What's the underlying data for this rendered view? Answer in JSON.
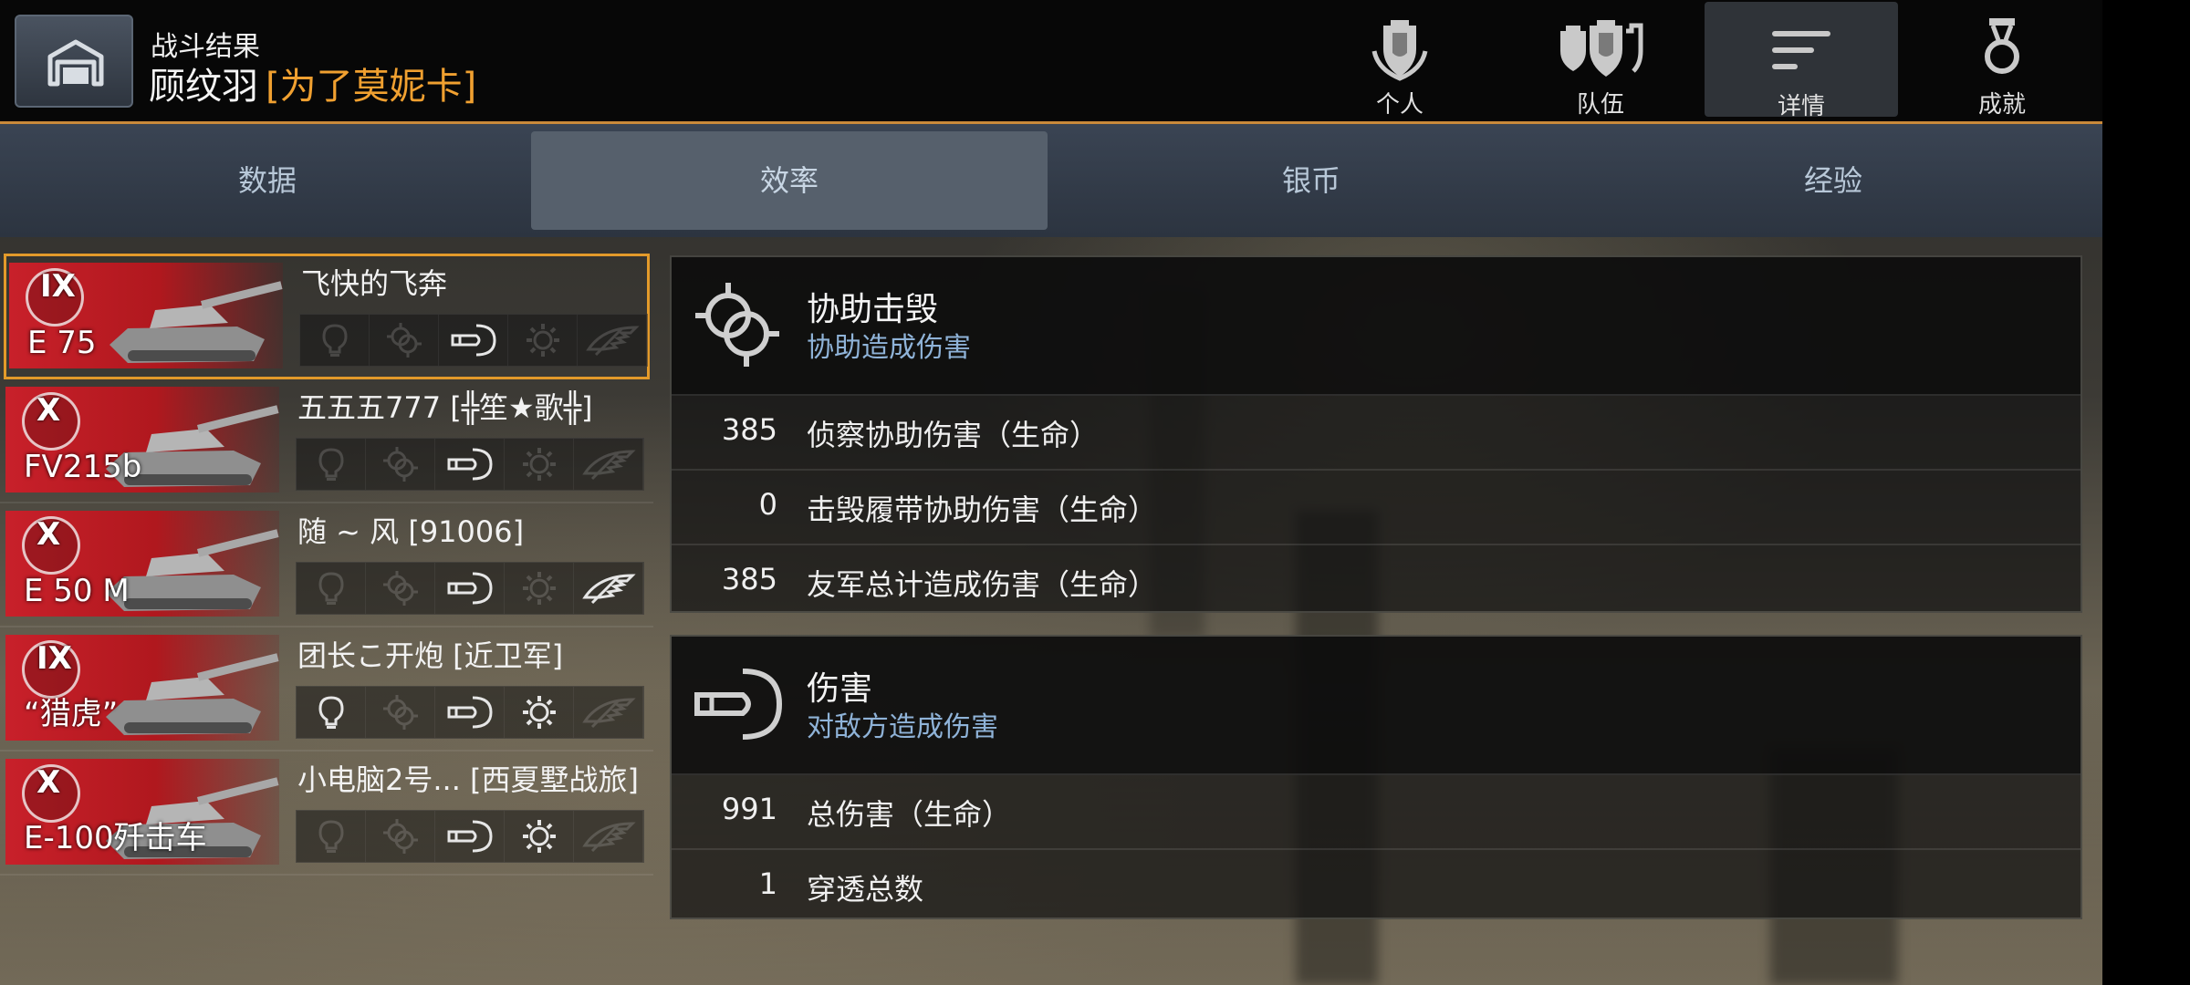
{
  "header": {
    "subtitle": "战斗结果",
    "player_name": "顾纹羽",
    "player_clan": "[为了莫妮卡]"
  },
  "nav": [
    {
      "label": "个人",
      "icon": "personal-badge-icon",
      "active": false
    },
    {
      "label": "队伍",
      "icon": "team-badge-icon",
      "active": false
    },
    {
      "label": "详情",
      "icon": "details-list-icon",
      "active": true
    },
    {
      "label": "成就",
      "icon": "medal-icon",
      "active": false
    }
  ],
  "tabs": [
    {
      "label": "数据",
      "active": false
    },
    {
      "label": "效率",
      "active": true
    },
    {
      "label": "银币",
      "active": false
    },
    {
      "label": "经验",
      "active": false
    }
  ],
  "vehicles": [
    {
      "tier": "IX",
      "vehicle": "E 75",
      "player": "飞快的飞奔",
      "badges": [
        false,
        false,
        true,
        false,
        false
      ],
      "selected": true
    },
    {
      "tier": "X",
      "vehicle": "FV215b",
      "player": "五五五777 [╬笙★歌╬]",
      "badges": [
        false,
        false,
        true,
        false,
        false
      ],
      "selected": false
    },
    {
      "tier": "X",
      "vehicle": "E 50 M",
      "player": "随 ~ 风 [91006]",
      "badges": [
        false,
        false,
        true,
        false,
        true
      ],
      "selected": false
    },
    {
      "tier": "IX",
      "vehicle": "“猎虎”",
      "player": "团长こ开炮 [近卫军]",
      "badges": [
        true,
        false,
        true,
        true,
        false
      ],
      "selected": false
    },
    {
      "tier": "X",
      "vehicle": "E-100歼击车",
      "player": "小电脑2号...  [西夏墅战旅]",
      "badges": [
        false,
        false,
        true,
        true,
        false
      ],
      "selected": false
    }
  ],
  "badge_icons": [
    "spotting-bulb-icon",
    "assist-icon",
    "shell-damage-icon",
    "gear-track-icon",
    "wing-icon"
  ],
  "panels": {
    "assist": {
      "title": "协助击毁",
      "subtitle": "协助造成伤害",
      "icon": "assist-icon",
      "rows": [
        {
          "value": "385",
          "label": "侦察协助伤害（生命）"
        },
        {
          "value": "0",
          "label": "击毁履带协助伤害（生命）"
        },
        {
          "value": "385",
          "label": "友军总计造成伤害（生命）"
        }
      ]
    },
    "damage": {
      "title": "伤害",
      "subtitle": "对敌方造成伤害",
      "icon": "shell-damage-icon",
      "rows": [
        {
          "value": "991",
          "label": "总伤害（生命）"
        },
        {
          "value": "1",
          "label": "穿透总数"
        }
      ]
    }
  },
  "colors": {
    "accent": "#e39a2a",
    "clan": "#f0a030",
    "subtitle_blue": "#8fb3d8",
    "vehicle_red": "#c8202a"
  }
}
